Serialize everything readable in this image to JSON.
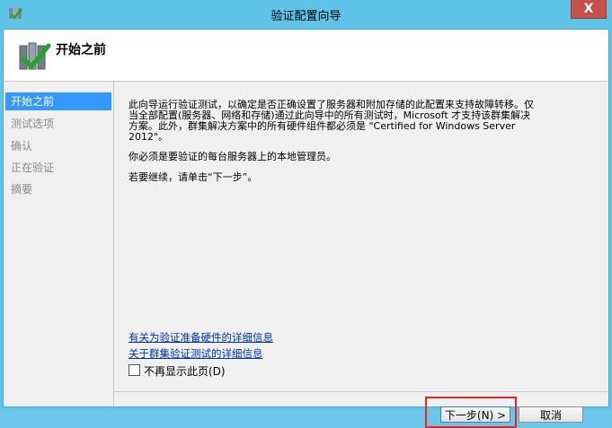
{
  "window": {
    "title": "验证配置向导",
    "close_label": "X"
  },
  "header": {
    "title": "开始之前"
  },
  "sidebar": {
    "items": [
      {
        "label": "开始之前",
        "active": true
      },
      {
        "label": "测试选项",
        "active": false
      },
      {
        "label": "确认",
        "active": false
      },
      {
        "label": "正在验证",
        "active": false
      },
      {
        "label": "摘要",
        "active": false
      }
    ]
  },
  "main": {
    "intro_line1": "此向导运行验证测试，以确定是否正确设置了服务器和附加存储的此配置来支持故障转移。仅",
    "intro_line2": "当全部配置(服务器、网络和存储)通过此向导中的所有测试时，Microsoft 才支持该群集解决",
    "intro_line3": "方案。此外，群集解决方案中的所有硬件组件都必须是 \"Certified for Windows Server",
    "intro_line4": "2012\"。",
    "admin_note": "你必须是要验证的每台服务器上的本地管理员。",
    "continue_note": "若要继续，请单击“下一步”。",
    "link_hardware": "有关为验证准备硬件的详细信息",
    "link_tests": "关于群集验证测试的详细信息",
    "dont_show_label": "不再显示此页(D)"
  },
  "buttons": {
    "next_label": "下一步(N) >",
    "cancel_label": "取消"
  },
  "colors": {
    "title_bar": "#5fc3ea",
    "active_step": "#3399ff",
    "link": "#0033aa",
    "highlight": "#e8232a",
    "close": "#c7504a"
  }
}
